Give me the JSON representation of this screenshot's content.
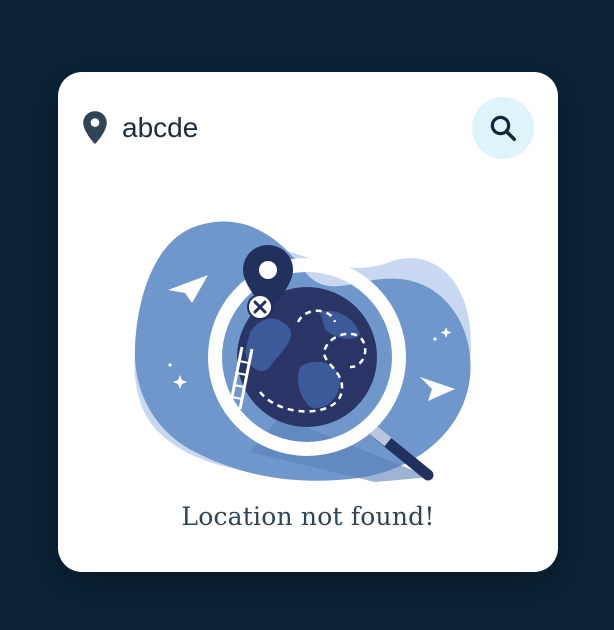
{
  "search": {
    "value": "abcde",
    "button_icon": "search-icon",
    "location_icon": "location-pin-icon"
  },
  "illustration": {
    "name": "not-found-globe-illustration"
  },
  "status": {
    "message": "Location not found!"
  },
  "colors": {
    "background": "#0b2438",
    "card": "#ffffff",
    "accent_light": "#dff3fb",
    "blob": "#6f97cc",
    "globe": "#2a3566",
    "text": "#2f4454"
  }
}
